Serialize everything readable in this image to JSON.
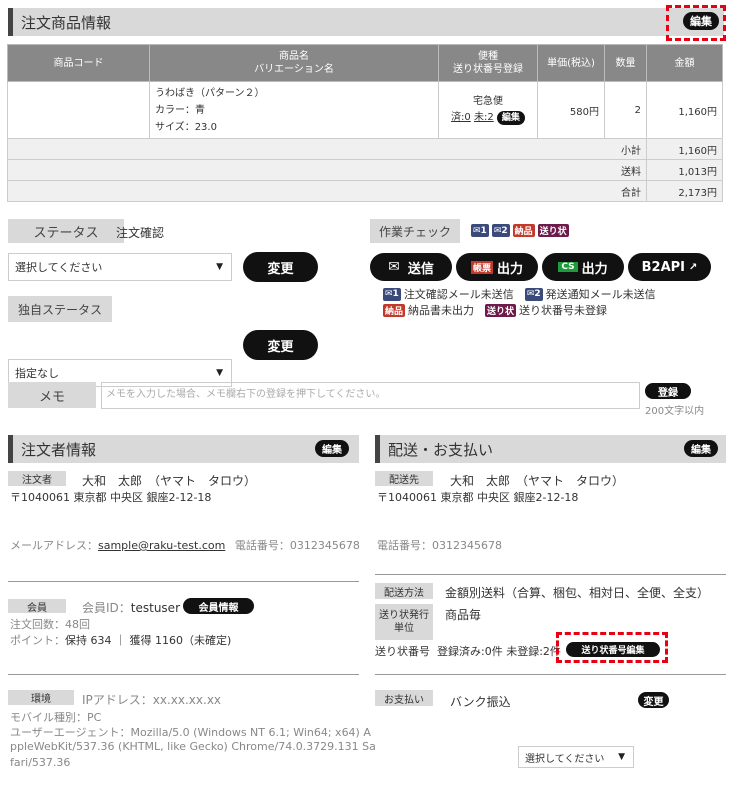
{
  "order_section": {
    "title": "注文商品情報",
    "edit_label": "編集"
  },
  "table": {
    "headers": {
      "code": "商品コード",
      "name_line1": "商品名",
      "name_line2": "バリエーション名",
      "ship_line1": "便種",
      "ship_line2": "送り状番号登録",
      "price": "単価(税込)",
      "qty": "数量",
      "amount": "金額"
    },
    "row": {
      "code": "",
      "name": "うわばき（パターン２）",
      "color": "カラー：青",
      "size": "サイズ：23.0",
      "ship_type": "宅急便",
      "ship_done": "済:0",
      "ship_undone": "未:2",
      "ship_edit": "編集",
      "price": "580円",
      "qty": "2",
      "amount": "1,160円"
    },
    "subtotal": {
      "label": "小計",
      "value": "1,160円"
    },
    "shipping": {
      "label": "送料",
      "value": "1,013円"
    },
    "total": {
      "label": "合計",
      "value": "2,173円"
    }
  },
  "status": {
    "label": "ステータス",
    "current": "注文確認",
    "select_value": "選択してください",
    "change_label": "変更"
  },
  "own_status": {
    "label": "独自ステータス",
    "select_value": "指定なし",
    "change_label": "変更"
  },
  "work_check": {
    "label": "作業チェック",
    "chip_mail1": "1",
    "chip_mail2": "2",
    "chip_delivery": "納品",
    "chip_invoice": "送り状",
    "btn_send": "送信",
    "btn_ledger_tag": "帳票",
    "btn_ledger": "出力",
    "btn_cs_tag": "CS",
    "btn_cs": "出力",
    "btn_b2api": "B2API",
    "legend1": "注文確認メール未送信",
    "legend2": "発送通知メール未送信",
    "legend3": "納品書未出力",
    "legend4": "送り状番号未登録"
  },
  "memo": {
    "label": "メモ",
    "placeholder": "メモを入力した場合、メモ欄右下の登録を押下してください。",
    "register_label": "登録",
    "limit": "200文字以内"
  },
  "orderer": {
    "title": "注文者情報",
    "edit_label": "編集",
    "tag": "注文者",
    "name": "大和　太郎　（ヤマト　タロウ）",
    "address": "〒1040061  東京都  中央区  銀座2-12-18",
    "email_label": "メールアドレス：",
    "email": "sample@raku-test.com",
    "phone": "電話番号：0312345678",
    "member_tag": "会員",
    "member_id_label": "会員ID：",
    "member_id": "testuser",
    "member_info_btn": "会員情報",
    "order_count": "注文回数：48回",
    "points_label": "ポイント：",
    "points": "保持 634 ｜ 獲得 1160（未確定)",
    "env_tag": "環境",
    "ip": "IPアドレス：xx.xx.xx.xx",
    "mobile": "モバイル種別：PC",
    "ua_line1": "ユーザーエージェント：Mozilla/5.0 (Windows NT 6.1; Win64; x64) A",
    "ua_line2": "ppleWebKit/537.36 (KHTML, like Gecko) Chrome/74.0.3729.131 Sa",
    "ua_line3": "fari/537.36"
  },
  "delivery": {
    "title": "配送・お支払い",
    "edit_label": "編集",
    "tag": "配送先",
    "name": "大和　太郎　（ヤマト　タロウ）",
    "address": "〒1040061  東京都  中央区  銀座2-12-18",
    "phone": "電話番号：0312345678",
    "method_tag": "配送方法",
    "method": "金額別送料（合算、梱包、相対日、全便、全支）",
    "unit_tag_line1": "送り状発行",
    "unit_tag_line2": "単位",
    "unit": "商品毎",
    "tracking_label": "送り状番号",
    "tracking_status": "登録済み:0件  未登録:2件",
    "tracking_edit_btn": "送り状番号編集",
    "payment_tag": "お支払い",
    "payment": "バンク振込",
    "payment_select": "選択してください",
    "payment_change": "変更"
  }
}
